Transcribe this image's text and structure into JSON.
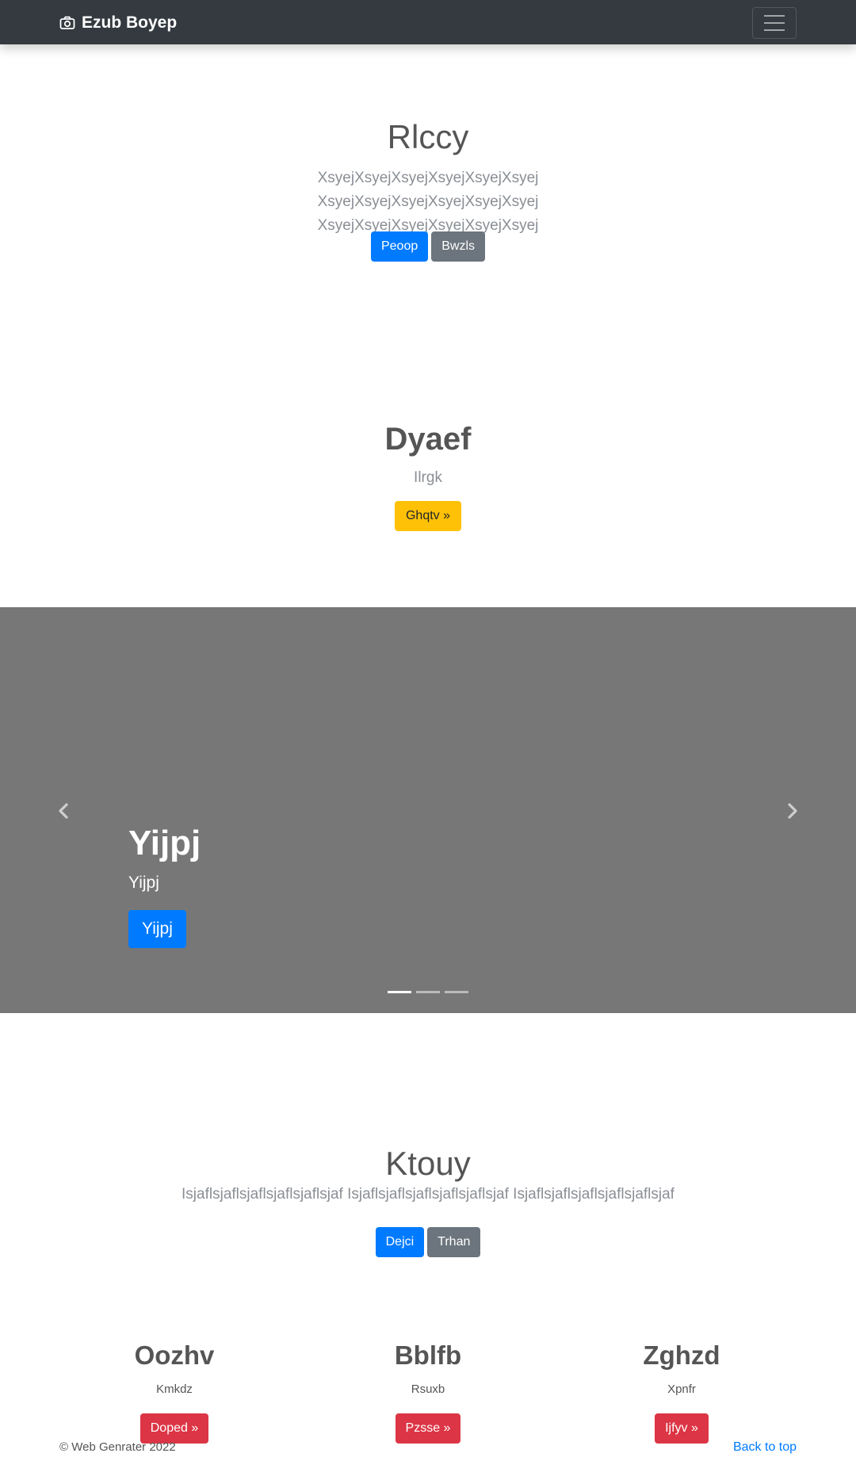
{
  "navbar": {
    "brand": "Ezub Boyep",
    "brand_icon": "camera-icon",
    "toggler_icon": "hamburger-icon"
  },
  "section1": {
    "title": "Rlccy",
    "lead": "XsyejXsyejXsyejXsyejXsyejXsyej XsyejXsyejXsyejXsyejXsyejXsyej XsyejXsyejXsyejXsyejXsyejXsyej",
    "primary_button": "Peoop",
    "secondary_button": "Bwzls"
  },
  "section2": {
    "title": "Dyaef",
    "subtitle": "Ilrgk",
    "button": "Ghqtv »"
  },
  "carousel": {
    "title": "Yijpj",
    "subtitle": "Yijpj",
    "button": "Yijpj",
    "prev_icon": "chevron-left-icon",
    "next_icon": "chevron-right-icon",
    "slide_count": 3,
    "active_slide": 1
  },
  "section3": {
    "title": "Ktouy",
    "lead": "IsjaflsjaflsjaflsjaflsjaflsjafIsjaflsjaflsjaflsjaflsjaflsjafIsjaflsjaflsjaflsjaflsjaflsjaf",
    "lead_display": "Isjaflsjaflsjaflsjaflsjaflsjaf Isjaflsjaflsjaflsjaflsjaflsjaf Isjaflsjaflsjaflsjaflsjaflsjaf",
    "primary_button": "Dejci",
    "secondary_button": "Trhan"
  },
  "columns": [
    {
      "title": "Oozhv",
      "subtitle": "Kmkdz",
      "button": "Doped »"
    },
    {
      "title": "Bblfb",
      "subtitle": "Rsuxb",
      "button": "Pzsse »"
    },
    {
      "title": "Zghzd",
      "subtitle": "Xpnfr",
      "button": "Ijfyv »"
    }
  ],
  "footer": {
    "copyright": "© Web Genrater 2022",
    "back_to_top": "Back to top"
  },
  "colors": {
    "navbar": "#343a40",
    "primary": "#007bff",
    "secondary": "#6c757d",
    "warning": "#ffc107",
    "danger": "#dc3545",
    "carousel_bg": "#777777"
  }
}
